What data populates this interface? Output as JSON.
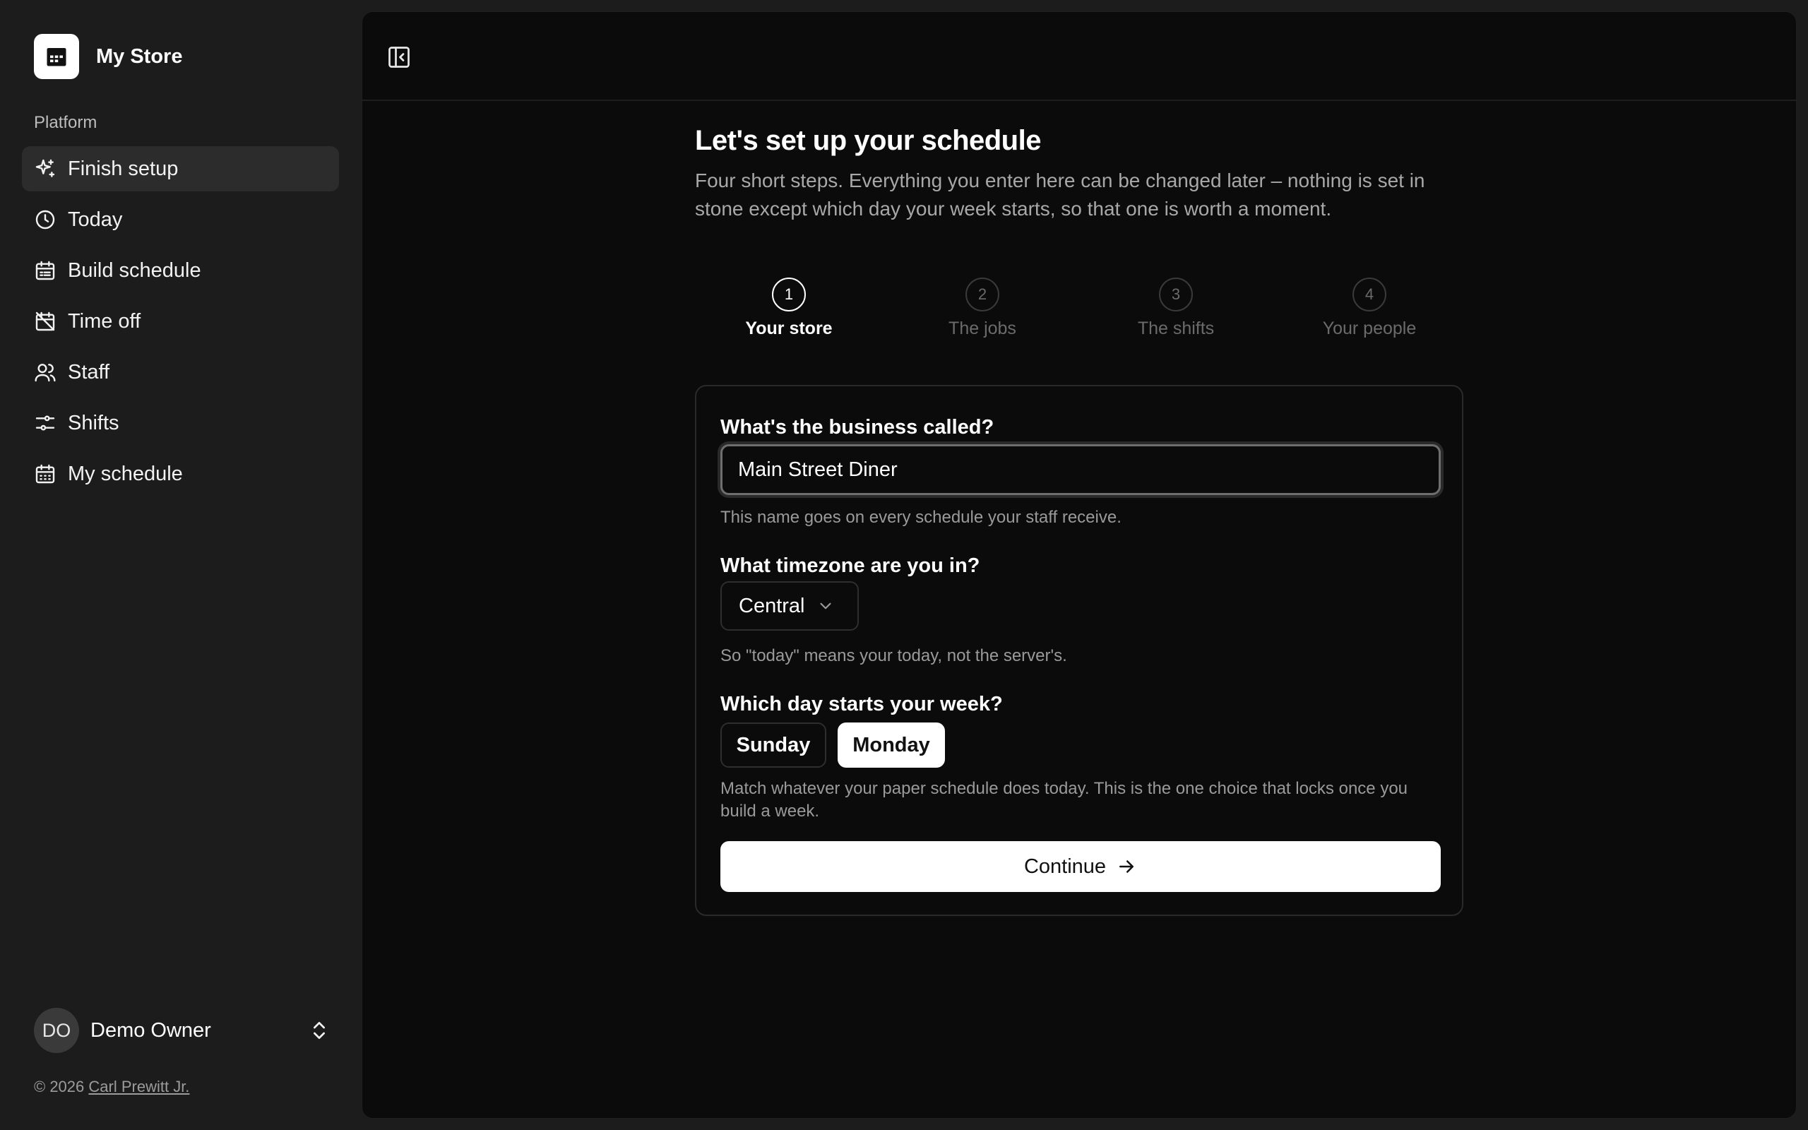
{
  "brand": {
    "name": "My Store",
    "logo_icon": "store-calendar-icon"
  },
  "sidebar": {
    "section_label": "Platform",
    "items": [
      {
        "label": "Finish setup",
        "icon": "sparkles-icon",
        "active": true
      },
      {
        "label": "Today",
        "icon": "clock-icon",
        "active": false
      },
      {
        "label": "Build schedule",
        "icon": "calendar-list-icon",
        "active": false
      },
      {
        "label": "Time off",
        "icon": "calendar-off-icon",
        "active": false
      },
      {
        "label": "Staff",
        "icon": "users-icon",
        "active": false
      },
      {
        "label": "Shifts",
        "icon": "sliders-icon",
        "active": false
      },
      {
        "label": "My schedule",
        "icon": "calendar-grid-icon",
        "active": false
      }
    ],
    "user": {
      "initials": "DO",
      "name": "Demo Owner"
    },
    "footer": {
      "copyright": "© 2026",
      "author": "Carl Prewitt Jr."
    }
  },
  "topbar": {
    "toggle_icon": "sidebar-toggle-icon"
  },
  "page": {
    "title": "Let's set up your schedule",
    "subtitle": "Four short steps. Everything you enter here can be changed later – nothing is set in stone except which day your week starts, so that one is worth a moment."
  },
  "steps": [
    {
      "number": "1",
      "label": "Your store",
      "current": true
    },
    {
      "number": "2",
      "label": "The jobs",
      "current": false
    },
    {
      "number": "3",
      "label": "The shifts",
      "current": false
    },
    {
      "number": "4",
      "label": "Your people",
      "current": false
    }
  ],
  "form": {
    "business": {
      "label": "What's the business called?",
      "value": "Main Street Diner",
      "hint": "This name goes on every schedule your staff receive."
    },
    "timezone": {
      "label": "What timezone are you in?",
      "value": "Central",
      "hint": "So \"today\" means your today, not the server's."
    },
    "week_start": {
      "label": "Which day starts your week?",
      "options": [
        "Sunday",
        "Monday"
      ],
      "selected": "Monday",
      "hint": "Match whatever your paper schedule does today. This is the one choice that locks once you build a week."
    },
    "continue_label": "Continue"
  },
  "colors": {
    "sidebar_bg": "#1c1c1c",
    "main_bg": "#0b0b0b",
    "accent": "#ffffff"
  }
}
